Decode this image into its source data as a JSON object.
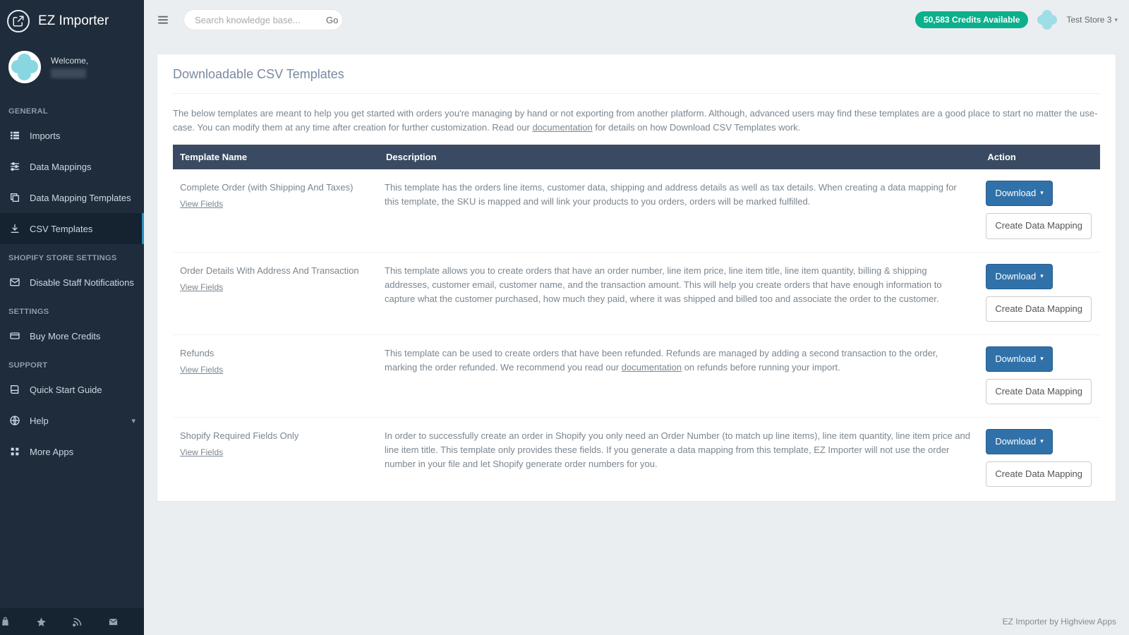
{
  "brand": {
    "name": "EZ Importer"
  },
  "welcome": {
    "label": "Welcome,"
  },
  "sidebar": {
    "sections": {
      "general": "GENERAL",
      "shopify": "SHOPIFY STORE SETTINGS",
      "settings": "SETTINGS",
      "support": "SUPPORT"
    },
    "items": {
      "imports": "Imports",
      "data_mappings": "Data Mappings",
      "data_mapping_templates": "Data Mapping Templates",
      "csv_templates": "CSV Templates",
      "disable_staff_notifications": "Disable Staff Notifications",
      "buy_more_credits": "Buy More Credits",
      "quick_start_guide": "Quick Start Guide",
      "help": "Help",
      "more_apps": "More Apps"
    }
  },
  "topbar": {
    "search_placeholder": "Search knowledge base...",
    "go": "Go",
    "credits": "50,583 Credits Available",
    "store": "Test Store 3"
  },
  "page": {
    "title": "Downloadable CSV Templates",
    "intro_a": "The below templates are meant to help you get started with orders you're managing by hand or not exporting from another platform. Although, advanced users may find these templates are a good place to start no matter the use-case. You can modify them at any time after creation for further customization. Read our ",
    "intro_link": "documentation",
    "intro_b": " for details on how Download CSV Templates work."
  },
  "table": {
    "headers": {
      "name": "Template Name",
      "desc": "Description",
      "action": "Action"
    },
    "view_fields": "View Fields",
    "download": "Download",
    "create_mapping": "Create Data Mapping",
    "rows": [
      {
        "name": "Complete Order (with Shipping And Taxes)",
        "desc": "This template has the orders line items, customer data, shipping and address details as well as tax details. When creating a data mapping for this template, the SKU is mapped and will link your products to you orders, orders will be marked fulfilled."
      },
      {
        "name": "Order Details With Address And Transaction",
        "desc": "This template allows you to create orders that have an order number, line item price, line item title, line item quantity, billing & shipping addresses, customer email, customer name, and the transaction amount. This will help you create orders that have enough information to capture what the customer purchased, how much they paid, where it was shipped and billed too and associate the order to the customer."
      },
      {
        "name": "Refunds",
        "desc_a": "This template can be used to create orders that have been refunded. Refunds are managed by adding a second transaction to the order, marking the order refunded. We recommend you read our ",
        "desc_link": "documentation",
        "desc_b": " on refunds before running your import."
      },
      {
        "name": "Shopify Required Fields Only",
        "desc": "In order to successfully create an order in Shopify you only need an Order Number (to match up line items), line item quantity, line item price and line item title. This template only provides these fields. If you generate a data mapping from this template, EZ Importer will not use the order number in your file and let Shopify generate order numbers for you."
      }
    ]
  },
  "footer": {
    "text": "EZ Importer by Highview Apps"
  }
}
